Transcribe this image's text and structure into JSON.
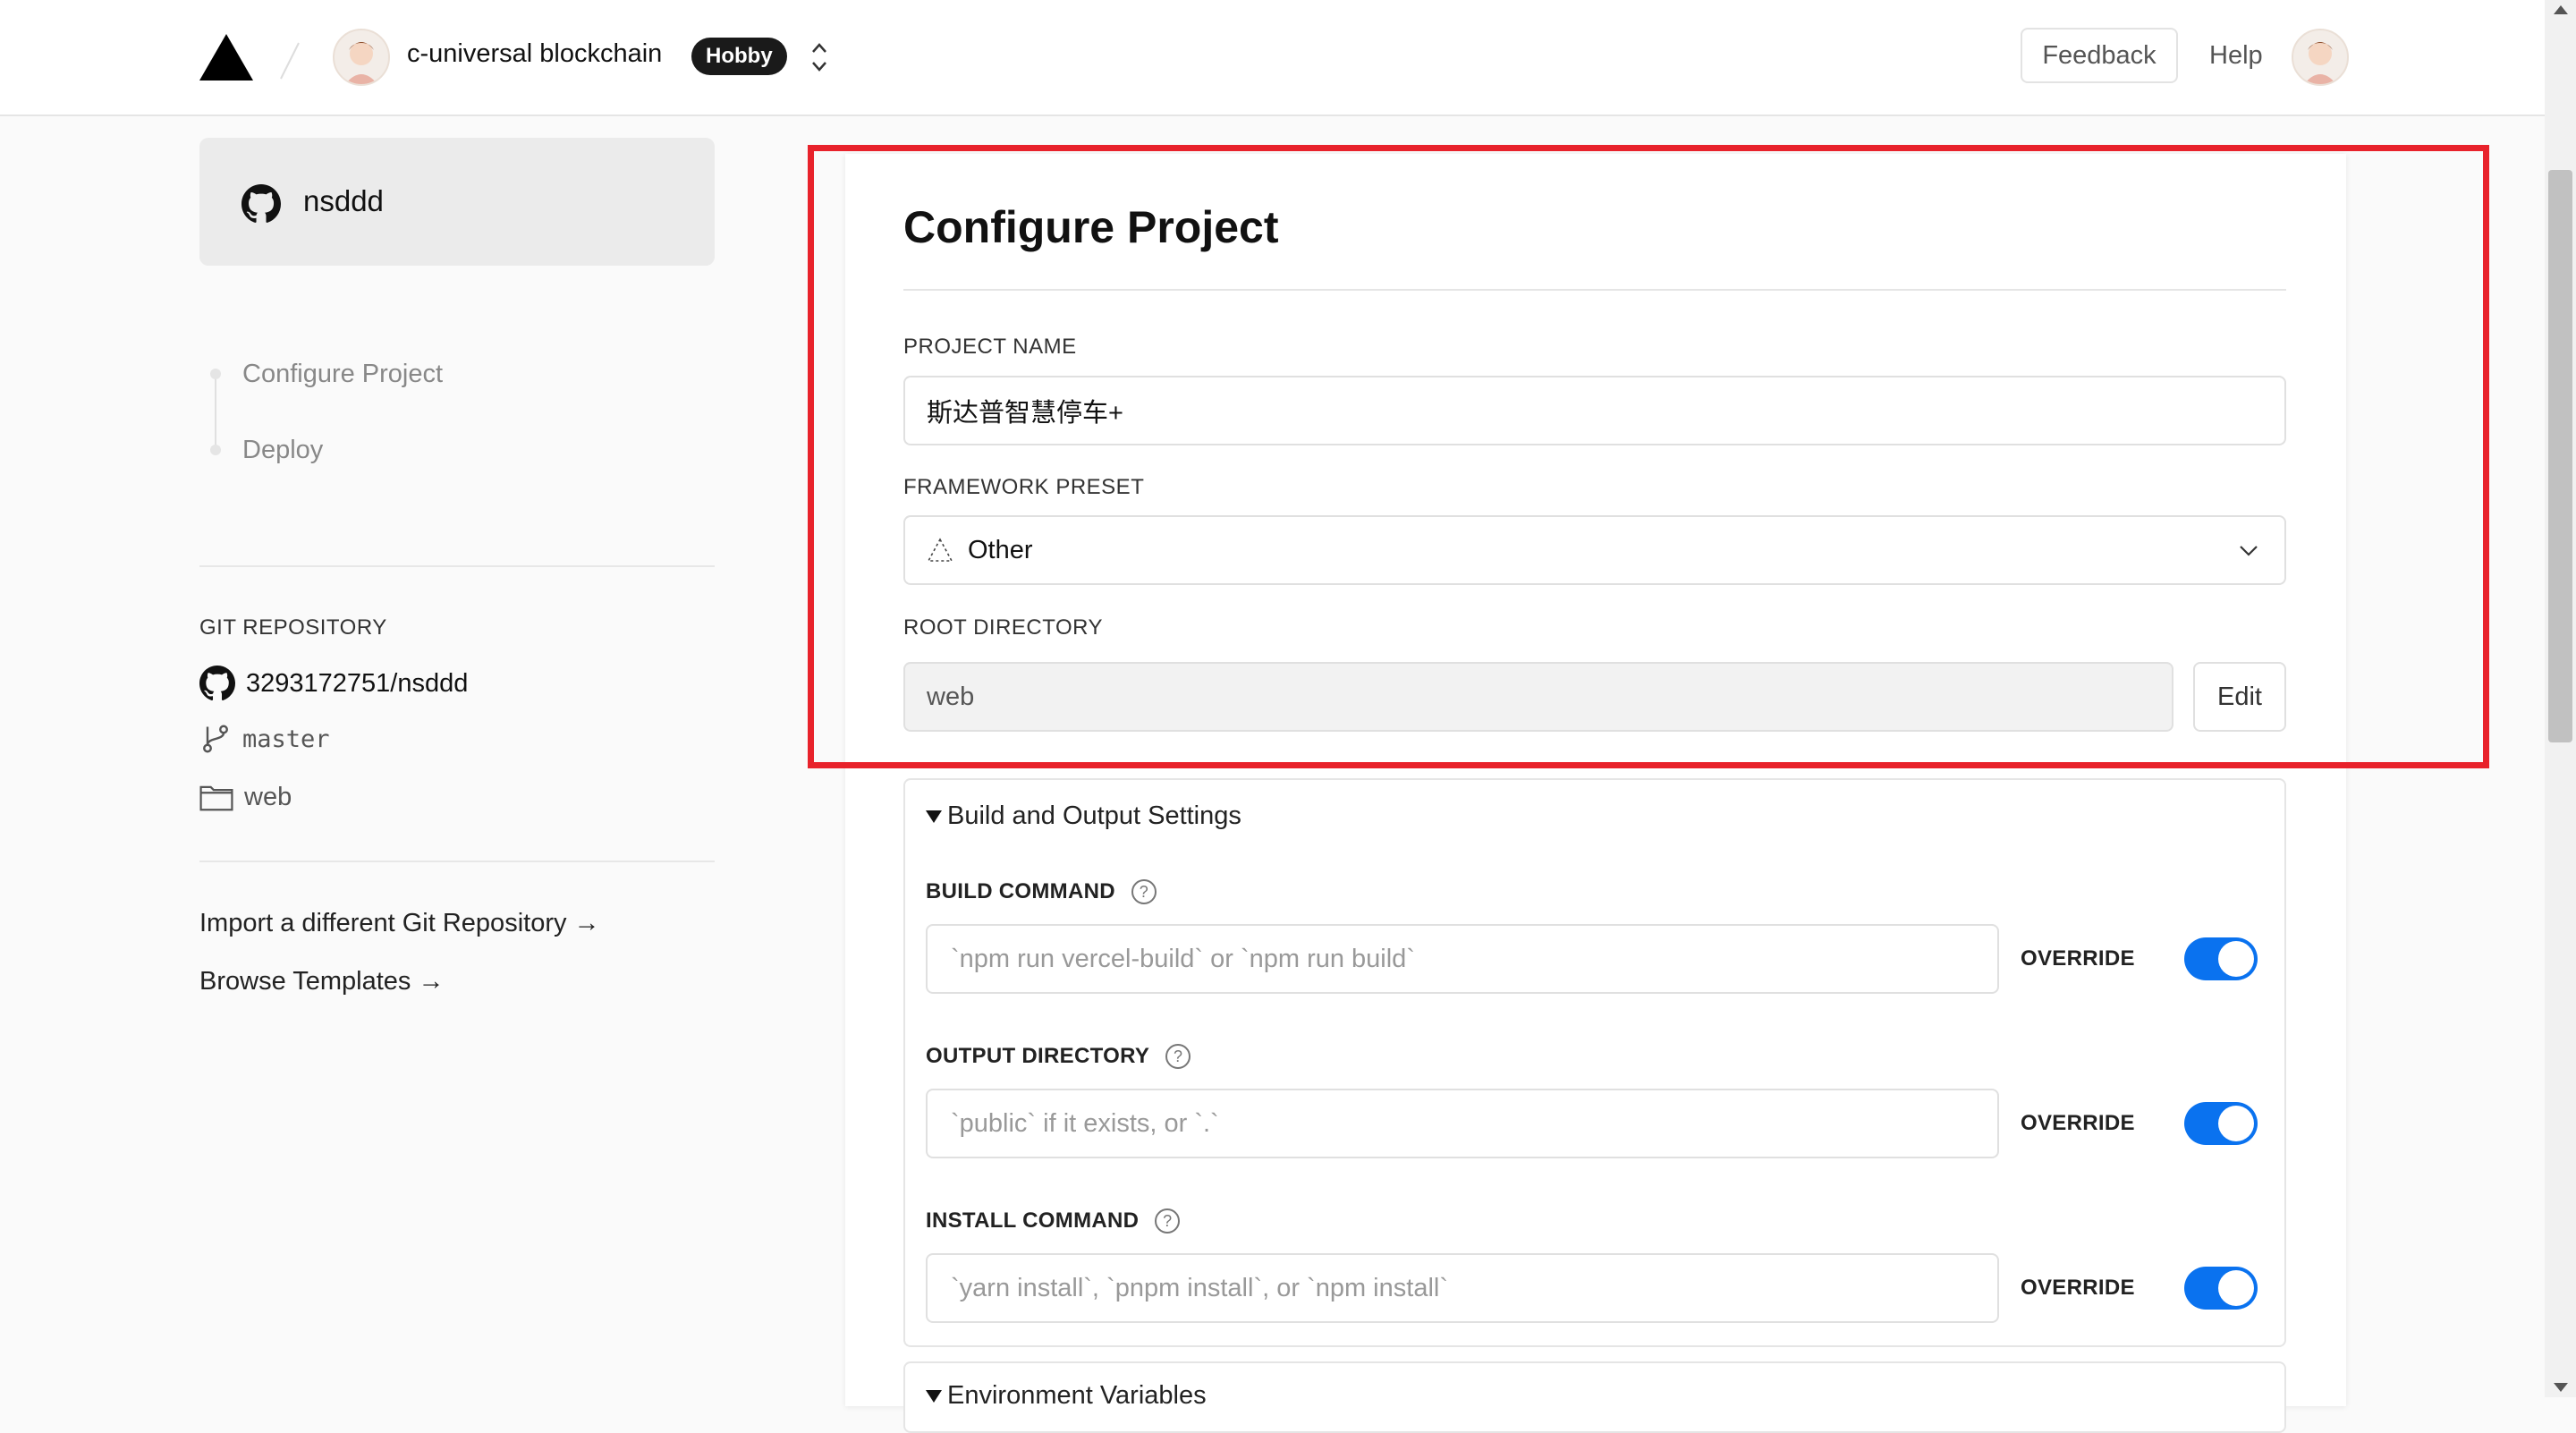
{
  "header": {
    "team_name": "c-universal blockchain",
    "plan_badge": "Hobby",
    "feedback_label": "Feedback",
    "help_label": "Help"
  },
  "sidebar": {
    "repo_card_name": "nsddd",
    "steps": [
      {
        "label": "Configure Project"
      },
      {
        "label": "Deploy"
      }
    ],
    "git_caption": "GIT REPOSITORY",
    "repo_full_name": "3293172751/nsddd",
    "branch": "master",
    "root_folder": "web",
    "links": {
      "import": "Import a different Git Repository →",
      "templates": "Browse Templates →"
    }
  },
  "main": {
    "title": "Configure Project",
    "project_name_label": "PROJECT NAME",
    "project_name_value": "斯达普智慧停车+",
    "framework_label": "FRAMEWORK PRESET",
    "framework_value": "Other",
    "root_dir_label": "ROOT DIRECTORY",
    "root_dir_value": "web",
    "edit_label": "Edit"
  },
  "build_settings": {
    "summary": "Build and Output Settings",
    "override_label": "OVERRIDE",
    "build_command": {
      "label": "BUILD COMMAND",
      "placeholder": "`npm run vercel-build` or `npm run build`",
      "override_on": true
    },
    "output_directory": {
      "label": "OUTPUT DIRECTORY",
      "placeholder": "`public` if it exists, or `.`",
      "override_on": true
    },
    "install_command": {
      "label": "INSTALL COMMAND",
      "placeholder": "`yarn install`, `pnpm install`, or `npm install`",
      "override_on": true
    }
  },
  "env_vars": {
    "summary": "Environment Variables"
  },
  "colors": {
    "accent": "#0a72ef",
    "highlight": "#e8222b"
  }
}
